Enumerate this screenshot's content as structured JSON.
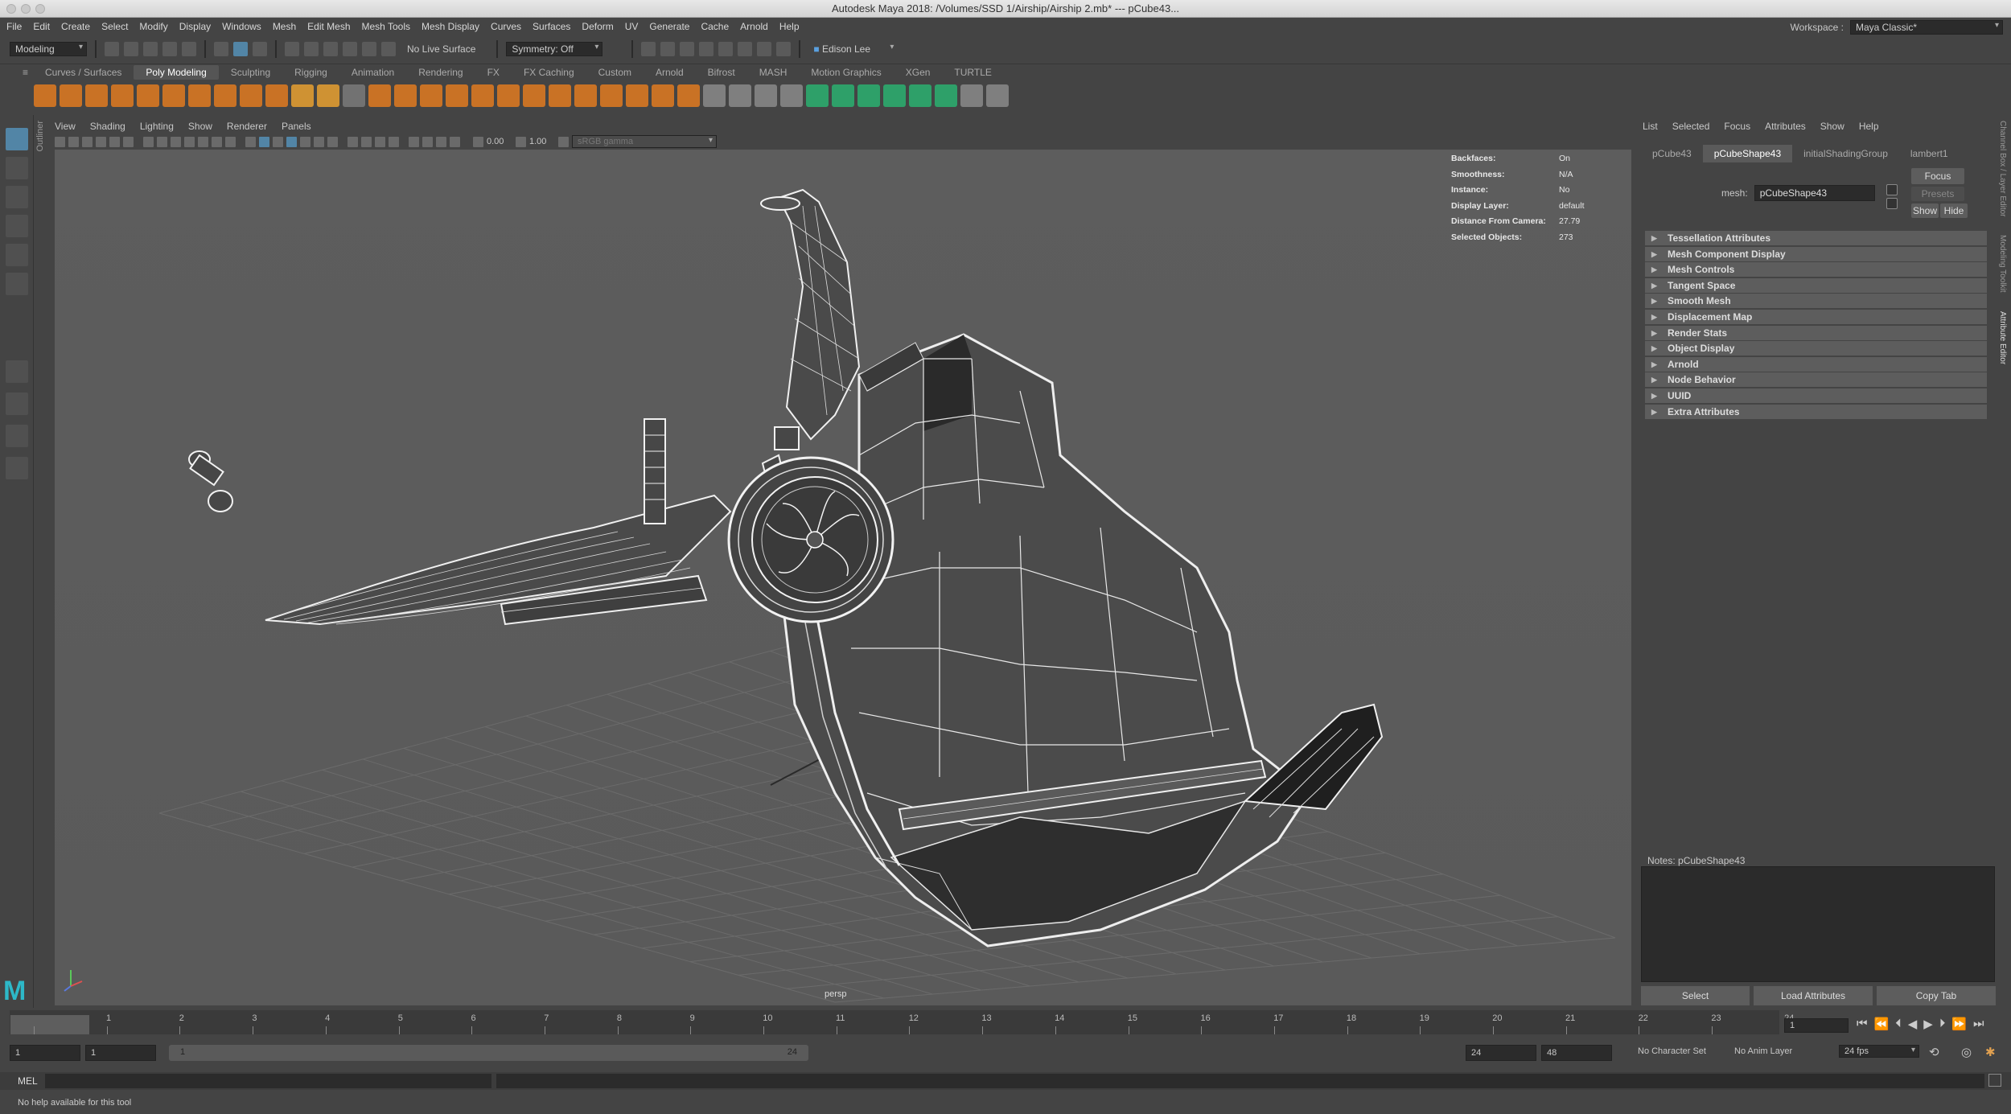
{
  "window": {
    "title": "Autodesk Maya 2018: /Volumes/SSD 1/Airship/Airship 2.mb*   ---   pCube43..."
  },
  "menus": [
    "File",
    "Edit",
    "Create",
    "Select",
    "Modify",
    "Display",
    "Windows",
    "Mesh",
    "Edit Mesh",
    "Mesh Tools",
    "Mesh Display",
    "Curves",
    "Surfaces",
    "Deform",
    "UV",
    "Generate",
    "Cache",
    "Arnold",
    "Help"
  ],
  "workspace": {
    "label": "Workspace :",
    "value": "Maya Classic*"
  },
  "statusline": {
    "mode": "Modeling",
    "live_surface": "No Live Surface",
    "symmetry": "Symmetry: Off",
    "user": "Edison Lee"
  },
  "shelf_tabs": [
    "Curves / Surfaces",
    "Poly Modeling",
    "Sculpting",
    "Rigging",
    "Animation",
    "Rendering",
    "FX",
    "FX Caching",
    "Custom",
    "Arnold",
    "Bifrost",
    "MASH",
    "Motion Graphics",
    "XGen",
    "TURTLE"
  ],
  "shelf_active": "Poly Modeling",
  "outliner_tab": "Outliner",
  "viewport": {
    "menus": [
      "View",
      "Shading",
      "Lighting",
      "Show",
      "Renderer",
      "Panels"
    ],
    "exposure": "0.00",
    "gamma": "1.00",
    "colorspace": "sRGB gamma",
    "camera": "persp",
    "hud": [
      {
        "k": "Backfaces:",
        "v": "On"
      },
      {
        "k": "Smoothness:",
        "v": "N/A"
      },
      {
        "k": "Instance:",
        "v": "No"
      },
      {
        "k": "Display Layer:",
        "v": "default"
      },
      {
        "k": "Distance From Camera:",
        "v": "27.79"
      },
      {
        "k": "Selected Objects:",
        "v": "273"
      }
    ]
  },
  "attribute_editor": {
    "menus": [
      "List",
      "Selected",
      "Focus",
      "Attributes",
      "Show",
      "Help"
    ],
    "tabs": [
      "pCube43",
      "pCubeShape43",
      "initialShadingGroup",
      "lambert1"
    ],
    "active_tab": "pCubeShape43",
    "mesh_label": "mesh:",
    "mesh_value": "pCubeShape43",
    "focus_btn": "Focus",
    "presets_btn": "Presets",
    "show_btn": "Show",
    "hide_btn": "Hide",
    "sections": [
      "Tessellation Attributes",
      "Mesh Component Display",
      "Mesh Controls",
      "Tangent Space",
      "Smooth Mesh",
      "Displacement Map",
      "Render Stats",
      "Object Display",
      "Arnold",
      "Node Behavior",
      "UUID",
      "Extra Attributes"
    ],
    "notes_label": "Notes:  pCubeShape43",
    "buttons": [
      "Select",
      "Load Attributes",
      "Copy Tab"
    ]
  },
  "right_vtabs": [
    "Channel Box / Layer Editor",
    "Modeling Toolkit",
    "Attribute Editor"
  ],
  "timeline": {
    "ticks": [
      "1",
      "2",
      "3",
      "4",
      "5",
      "6",
      "7",
      "8",
      "9",
      "10",
      "11",
      "12",
      "13",
      "14",
      "15",
      "16",
      "17",
      "18",
      "19",
      "20",
      "21",
      "22",
      "23",
      "24"
    ],
    "current_frame": "1",
    "range_start": "1",
    "range_inner_start": "1",
    "range_bar_start": "1",
    "range_bar_end": "24",
    "range_end": "24",
    "anim_end": "48",
    "character_set": "No Character Set",
    "anim_layer": "No Anim Layer",
    "fps": "24 fps"
  },
  "command": {
    "lang": "MEL",
    "help": "No help available for this tool"
  }
}
